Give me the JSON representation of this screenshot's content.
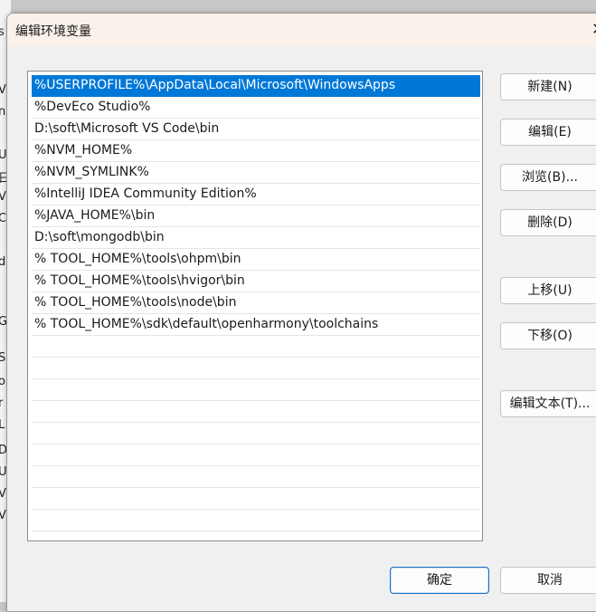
{
  "dialog": {
    "title": "编辑环境变量",
    "close_glyph": "✕"
  },
  "background_fragments": [
    "s",
    "V",
    "n",
    "U",
    "日",
    "V",
    "C",
    "d",
    "G",
    "S",
    "o",
    "r",
    "L",
    "D",
    "U",
    "V",
    "V"
  ],
  "path_list": [
    {
      "value": "%USERPROFILE%\\AppData\\Local\\Microsoft\\WindowsApps",
      "selected": true
    },
    {
      "value": "%DevEco Studio%",
      "selected": false
    },
    {
      "value": "D:\\soft\\Microsoft VS Code\\bin",
      "selected": false
    },
    {
      "value": "%NVM_HOME%",
      "selected": false
    },
    {
      "value": "%NVM_SYMLINK%",
      "selected": false
    },
    {
      "value": "%IntelliJ IDEA Community Edition%",
      "selected": false
    },
    {
      "value": "%JAVA_HOME%\\bin",
      "selected": false
    },
    {
      "value": "D:\\soft\\mongodb\\bin",
      "selected": false
    },
    {
      "value": "% TOOL_HOME%\\tools\\ohpm\\bin",
      "selected": false
    },
    {
      "value": "% TOOL_HOME%\\tools\\hvigor\\bin",
      "selected": false
    },
    {
      "value": "% TOOL_HOME%\\tools\\node\\bin",
      "selected": false
    },
    {
      "value": "% TOOL_HOME%\\sdk\\default\\openharmony\\toolchains",
      "selected": false
    },
    {
      "value": "",
      "selected": false
    },
    {
      "value": "",
      "selected": false
    },
    {
      "value": "",
      "selected": false
    },
    {
      "value": "",
      "selected": false
    },
    {
      "value": "",
      "selected": false
    },
    {
      "value": "",
      "selected": false
    },
    {
      "value": "",
      "selected": false
    },
    {
      "value": "",
      "selected": false
    },
    {
      "value": "",
      "selected": false
    }
  ],
  "buttons": {
    "new": "新建(N)",
    "edit": "编辑(E)",
    "browse": "浏览(B)...",
    "delete": "删除(D)",
    "move_up": "上移(U)",
    "move_down": "下移(O)",
    "edit_text": "编辑文本(T)...",
    "ok": "确定",
    "cancel": "取消"
  },
  "colors": {
    "selection": "#0078d7",
    "titlebar": "#faf1ea",
    "dialog_bg": "#f0f0f0"
  }
}
